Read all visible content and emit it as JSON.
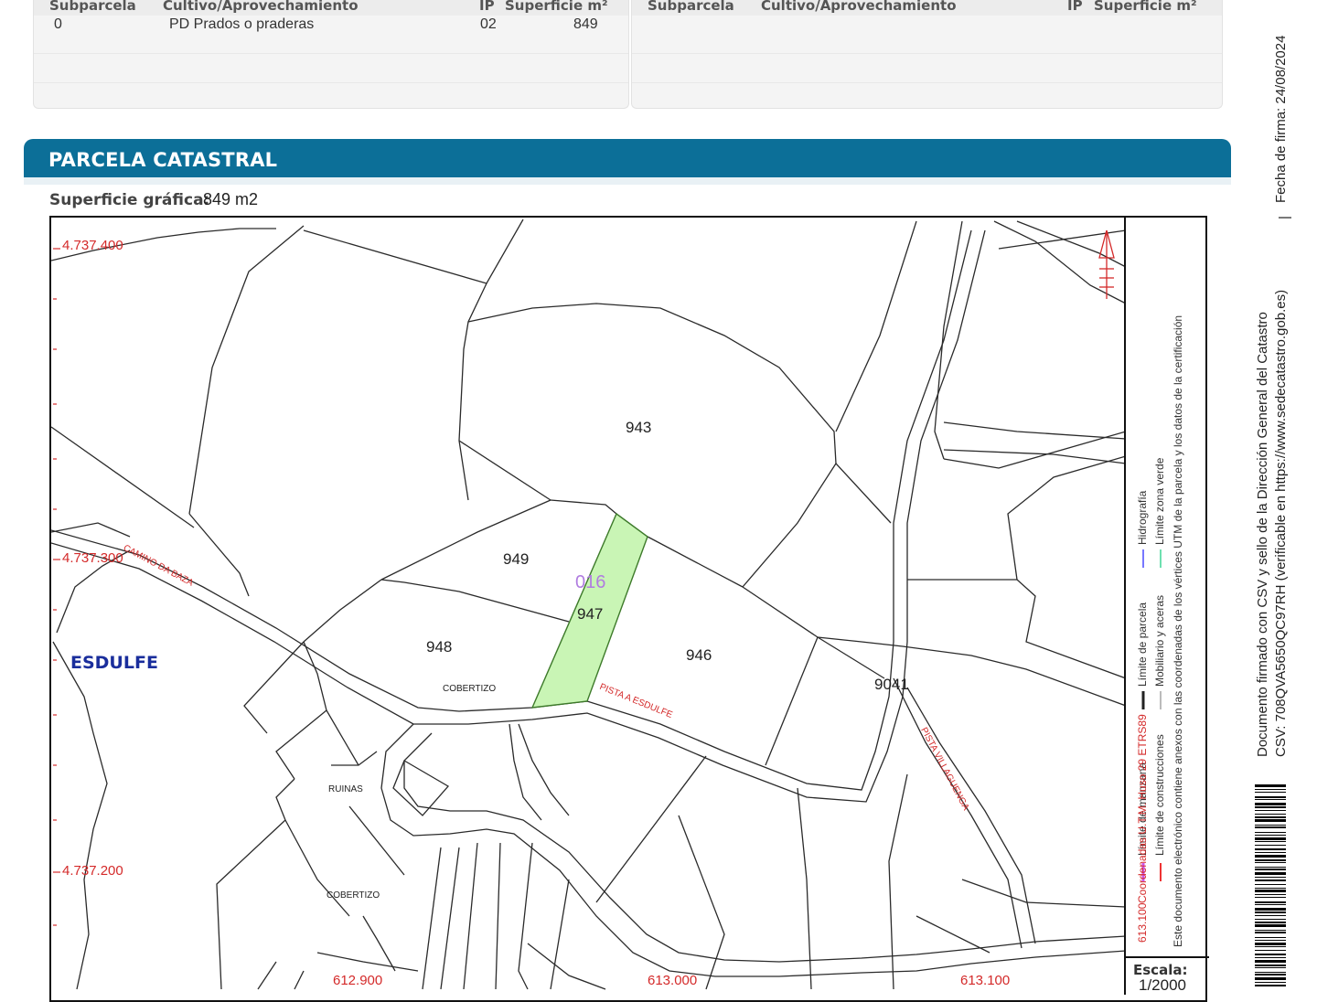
{
  "table_left": {
    "headers": [
      "Subparcela",
      "Cultivo/Aprovechamiento",
      "IP",
      "Superficie m²"
    ],
    "rows": [
      [
        "0",
        "PD Prados o praderas",
        "02",
        "849"
      ]
    ]
  },
  "table_right": {
    "headers": [
      "Subparcela",
      "Cultivo/Aprovechamiento",
      "IP",
      "Superficie m²"
    ]
  },
  "section": {
    "title": "PARCELA CATASTRAL",
    "sup_label": "Superficie gráfica:",
    "sup_value": "849 m2"
  },
  "map": {
    "coords": {
      "y1": "4.737.400",
      "y2": "4.737.300",
      "y3": "4.737.200",
      "x1": "612.900",
      "x2": "613.000",
      "x3": "613.100",
      "x_legend": "613.100"
    },
    "parcels": {
      "p943": "943",
      "p949": "949",
      "p948": "948",
      "p947": "947",
      "p946": "946",
      "p9041": "9041",
      "poly": "016"
    },
    "labels": {
      "place": "ESDULFE",
      "camino": "CAMINO DA BAZA",
      "pista_esdulfe": "PISTA A ESDULFE",
      "pista_villaguenga": "PISTA VILLAGUENGA",
      "cobertizo1": "COBERTIZO",
      "cobertizo2": "COBERTIZO",
      "ruinas": "RUINAS"
    },
    "colors": {
      "highlight_fill": "#c9f5b5",
      "highlight_stroke": "#3d7a2a",
      "coord_red": "#d42a2a",
      "place_blue": "#1a2e9c",
      "poly_purple": "#b07ce0"
    }
  },
  "legend": {
    "item1": "Límite de manzana",
    "item2": "Límite de parcela",
    "item3": "Hidrografía",
    "item4": "Límite de construcciones",
    "item5": "Mobiliario y aceras",
    "item6": "Límite zona verde",
    "coords_note": "Coordenadas U.T.M. Huso 29 ETRS89",
    "annex_note": "Este documento electrónico contiene anexos con las coordenadas de los vértices UTM de la parcela y los datos de la certificación"
  },
  "scale": {
    "label": "Escala:",
    "value": "1/2000"
  },
  "side": {
    "fecha": "Fecha de firma: 24/08/2024",
    "separator": "|",
    "doc_line": "Documento firmado con CSV y sello de la Dirección General del Catastro",
    "csv_line": "CSV: 708QVA5650QC97RH (verificable en https://www.sedecatastro.gob.es)"
  }
}
